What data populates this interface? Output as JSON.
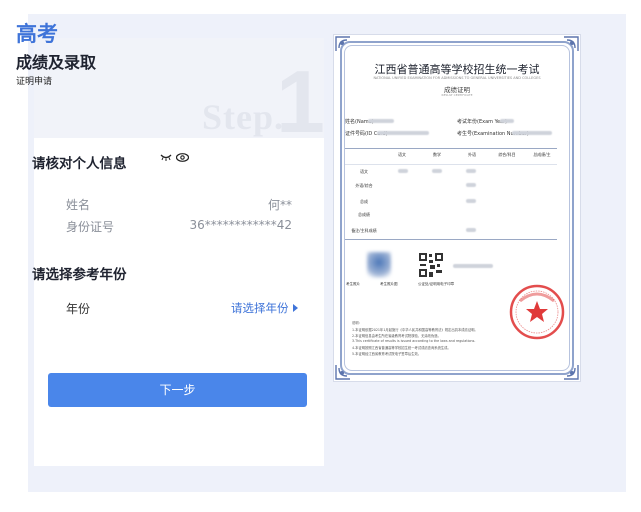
{
  "panel": {
    "title_top": "高考",
    "title_main": "成绩及录取",
    "title_sub": "证明申请",
    "step_word": "Step.",
    "step_num": "1"
  },
  "personal": {
    "heading": "请核对个人信息",
    "name_label": "姓名",
    "name_value": "何**",
    "id_label": "身份证号",
    "id_value": "36************42"
  },
  "year": {
    "heading": "请选择参考年份",
    "label": "年份",
    "placeholder": "请选择年份"
  },
  "next_button": "下一步",
  "certificate": {
    "title": "江西省普通高等学校招生统一考试",
    "title_en": "NATIONAL UNIFIED EXAMINATION FOR ADMISSIONS TO GENERAL UNIVERSITIES AND COLLEGES",
    "subtitle": "成绩证明",
    "subtitle_en": "RESULT CERTIFICATE",
    "fields": {
      "name": "姓名(Name)",
      "year": "考试年份(Exam Year)",
      "id": "证件号码(ID Card)",
      "exam_no": "考生号(Examination Number)"
    },
    "table_headers": [
      "语文",
      "数学",
      "外语",
      "综合/科目",
      "总成绩/主"
    ],
    "table_rows": [
      "语文",
      "外语/综合",
      "总成",
      "总成绩",
      "备注/主科成绩"
    ],
    "labels": [
      "考生照片",
      "考生照片图",
      "公证处/证明用电子印章"
    ],
    "notes": [
      "说明:",
      "1.本证明依据2021年1月起施行《中华人民共和国高等教育法》规定出具本成绩证明。",
      "2.本证明信息由考生所在省级教育考试院核验，无涂改伪造。",
      "3.This certificate of results is issued according to the laws and regulations.",
      "4.本证明按照江西省普通高等学校招生统一考试成绩查询系统生成。",
      "5.本证明经江西省教育考试院电子签章后生效。"
    ]
  },
  "colors": {
    "accent": "#3f74d9",
    "button": "#4a86ea",
    "canvas": "#eef1fa",
    "seal": "#e03a3a"
  }
}
